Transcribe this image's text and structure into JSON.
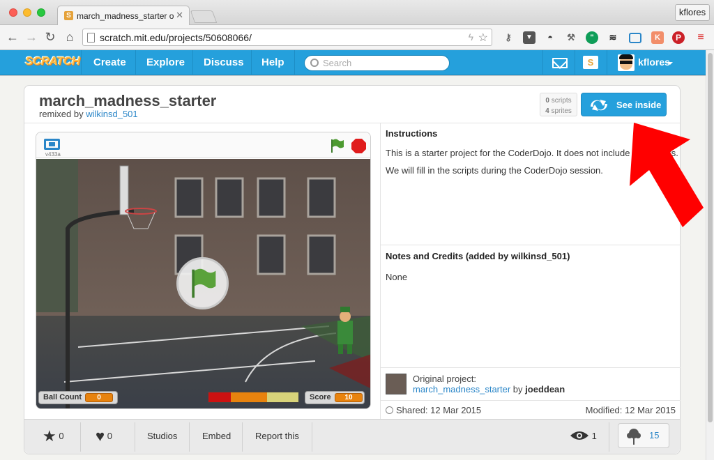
{
  "browser": {
    "tab_title": "march_madness_starter on",
    "tab_favicon": "S",
    "url": "scratch.mit.edu/projects/50608066/",
    "profile": "kflores"
  },
  "scratch_nav": {
    "logo": "SCRATCH",
    "links": [
      "Create",
      "Explore",
      "Discuss",
      "Help"
    ],
    "search_placeholder": "Search",
    "user": "kflores"
  },
  "project": {
    "title": "march_madness_starter",
    "remixed_prefix": "remixed by",
    "remixed_by": "wilkinsd_501",
    "scripts_count": "0",
    "scripts_label": "scripts",
    "sprites_count": "4",
    "sprites_label": "sprites",
    "see_inside": "See inside",
    "version": "v433a"
  },
  "stage": {
    "ball_count_label": "Ball Count",
    "ball_count_value": "0",
    "score_label": "Score",
    "score_value": "10",
    "meter_colors": [
      "#cc1111",
      "#e8830e",
      "#d8d37a"
    ]
  },
  "details": {
    "instructions_title": "Instructions",
    "instructions_text": "This is a starter project for the CoderDojo. It does not include any scripts. We will fill in the scripts during the CoderDojo session.",
    "notes_title": "Notes and Credits (added by wilkinsd_501)",
    "notes_text": "None",
    "original_label": "Original project:",
    "original_project": "march_madness_starter",
    "original_by_word": "by",
    "original_author": "joeddean",
    "shared": "Shared: 12 Mar 2015",
    "modified": "Modified: 12 Mar 2015"
  },
  "actions": {
    "favorites": "0",
    "loves": "0",
    "studios": "Studios",
    "embed": "Embed",
    "report": "Report this",
    "views": "1",
    "remixes": "15"
  },
  "colors": {
    "scratch_blue": "#25a0dc",
    "link_blue": "#2a86c8",
    "annotation_arrow": "#ff0000"
  }
}
